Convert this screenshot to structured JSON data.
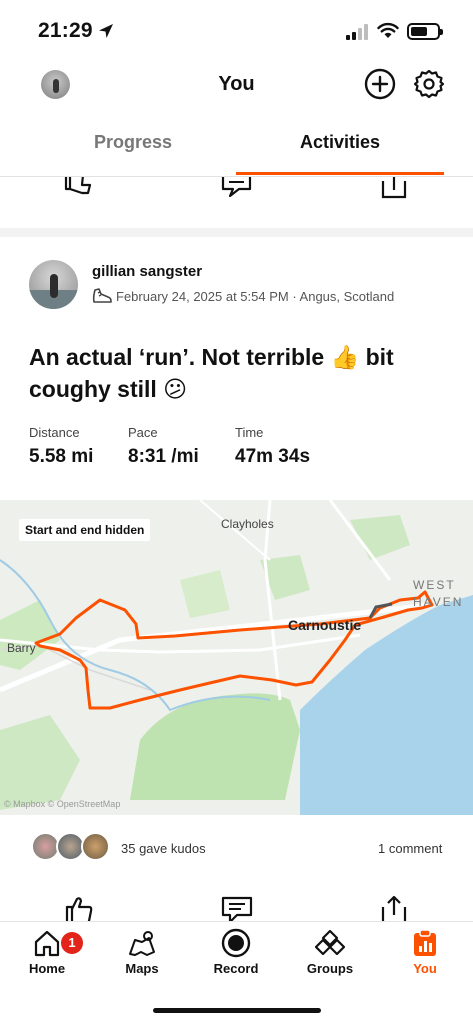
{
  "status_bar": {
    "time": "21:29"
  },
  "header": {
    "title": "You"
  },
  "tabs": {
    "progress": "Progress",
    "activities": "Activities"
  },
  "activity": {
    "athlete": "gillian sangster",
    "meta": "February 24, 2025 at 5:54 PM · Angus, Scotland",
    "title": "An actual ‘run’. Not terrible 👍 bit coughy still 😕",
    "stats": [
      {
        "label": "Distance",
        "value": "5.58 mi"
      },
      {
        "label": "Pace",
        "value": "8:31 /mi"
      },
      {
        "label": "Time",
        "value": "47m 34s"
      }
    ],
    "map": {
      "badge": "Start and end hidden",
      "places": {
        "clayholes": "Clayholes",
        "barry": "Barry",
        "carnoustie": "Carnoustie",
        "west": "WEST",
        "haven": "HAVEN"
      },
      "credit": "© Mapbox © OpenStreetMap"
    },
    "kudos_text": "35 gave kudos",
    "comment_text": "1 comment"
  },
  "tabbar": {
    "items": [
      {
        "label": "Home",
        "icon": "home-icon"
      },
      {
        "label": "Maps",
        "icon": "maps-icon"
      },
      {
        "label": "Record",
        "icon": "record-icon"
      },
      {
        "label": "Groups",
        "icon": "groups-icon"
      },
      {
        "label": "You",
        "icon": "you-icon"
      }
    ],
    "home_badge": "1"
  },
  "colors": {
    "accent": "#fc5200",
    "badge": "#e3241b",
    "route": "#fc5200",
    "water": "#a9d3ea",
    "park": "#bfe3b0"
  }
}
